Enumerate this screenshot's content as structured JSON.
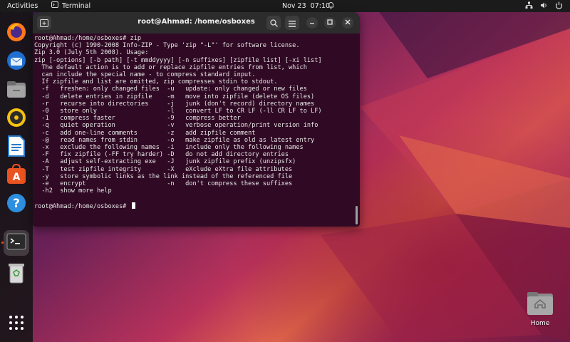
{
  "topbar": {
    "activities": "Activities",
    "app_name": "Terminal",
    "date": "Nov 23",
    "time": "07:10"
  },
  "dock": {
    "items": [
      {
        "name": "firefox-icon"
      },
      {
        "name": "thunderbird-icon"
      },
      {
        "name": "files-icon"
      },
      {
        "name": "rhythmbox-icon"
      },
      {
        "name": "libreoffice-writer-icon"
      },
      {
        "name": "app-center-icon"
      },
      {
        "name": "help-icon"
      },
      {
        "name": "terminal-icon"
      },
      {
        "name": "trash-icon"
      },
      {
        "name": "show-apps-icon"
      }
    ]
  },
  "terminal": {
    "title": "root@Ahmad: /home/osboxes",
    "lines": [
      "root@Ahmad:/home/osboxes# zip",
      "Copyright (c) 1990-2008 Info-ZIP - Type 'zip \"-L\"' for software license.",
      "Zip 3.0 (July 5th 2008). Usage:",
      "zip [-options] [-b path] [-t mmddyyyy] [-n suffixes] [zipfile list] [-xi list]",
      "  The default action is to add or replace zipfile entries from list, which",
      "  can include the special name - to compress standard input.",
      "  If zipfile and list are omitted, zip compresses stdin to stdout.",
      "  -f   freshen: only changed files  -u   update: only changed or new files",
      "  -d   delete entries in zipfile    -m   move into zipfile (delete OS files)",
      "  -r   recurse into directories     -j   junk (don't record) directory names",
      "  -0   store only                   -l   convert LF to CR LF (-ll CR LF to LF)",
      "  -1   compress faster              -9   compress better",
      "  -q   quiet operation              -v   verbose operation/print version info",
      "  -c   add one-line comments        -z   add zipfile comment",
      "  -@   read names from stdin        -o   make zipfile as old as latest entry",
      "  -x   exclude the following names  -i   include only the following names",
      "  -F   fix zipfile (-FF try harder) -D   do not add directory entries",
      "  -A   adjust self-extracting exe   -J   junk zipfile prefix (unzipsfx)",
      "  -T   test zipfile integrity       -X   eXclude eXtra file attributes",
      "  -y   store symbolic links as the link instead of the referenced file",
      "  -e   encrypt                      -n   don't compress these suffixes",
      "  -h2  show more help",
      "",
      "root@Ahmad:/home/osboxes# "
    ]
  },
  "desktop": {
    "home_label": "Home"
  },
  "colors": {
    "terminal_bg": "#300a24",
    "ubuntu_orange": "#e95420"
  }
}
